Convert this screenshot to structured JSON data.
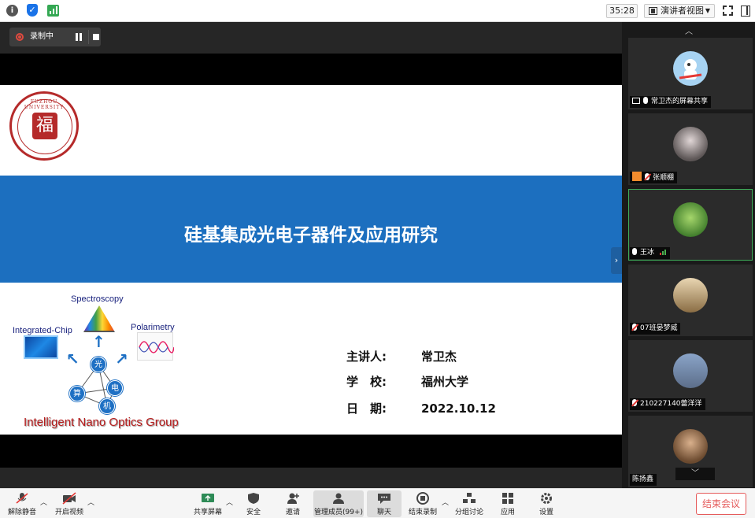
{
  "topbar": {
    "timer": "35:28",
    "view_label": "演讲者视图",
    "icons": [
      "info-icon",
      "shield-icon",
      "signal-icon",
      "grid-icon",
      "fullscreen-icon",
      "window-icon"
    ]
  },
  "recording": {
    "label": "录制中"
  },
  "slide": {
    "logo_text": "FUZHOU UNIVERSITY",
    "logo_char": "福",
    "title": "硅基集成光电子器件及应用研究",
    "diagram": {
      "spectroscopy": "Spectroscopy",
      "integrated_chip": "Integrated-Chip",
      "polarimetry": "Polarimetry",
      "nodes": [
        "光",
        "电",
        "算",
        "机"
      ]
    },
    "group_name": "Intelligent Nano Optics Group",
    "speaker_key": "主讲人:",
    "speaker_val": "常卫杰",
    "school_key": "学　校:",
    "school_val": "福州大学",
    "date_key": "日　期:",
    "date_val": "2022.10.12"
  },
  "participants": [
    {
      "name": "常卫杰的屏幕共享",
      "status": "sharing"
    },
    {
      "name": "张顺棚",
      "status": "muted"
    },
    {
      "name": "王冰",
      "status": "speaking"
    },
    {
      "name": "07班晏梦威",
      "status": "muted"
    },
    {
      "name": "210227140蕾洋洋",
      "status": "muted"
    },
    {
      "name": "陈扬鑫",
      "status": "muted"
    }
  ],
  "toolbar": {
    "unmute": "解除静音",
    "start_video": "开启视频",
    "share_screen": "共享屏幕",
    "security": "安全",
    "invite": "邀请",
    "participants": "管理成员(99+)",
    "chat": "聊天",
    "end_recording": "结束录制",
    "breakout": "分组讨论",
    "apps": "应用",
    "settings": "设置",
    "end_meeting": "结束会议"
  },
  "colors": {
    "banner": "#1c6fbf",
    "brand_red": "#b52a2a",
    "active_speaker": "#3fae5a",
    "end_button": "#e55b5b"
  }
}
